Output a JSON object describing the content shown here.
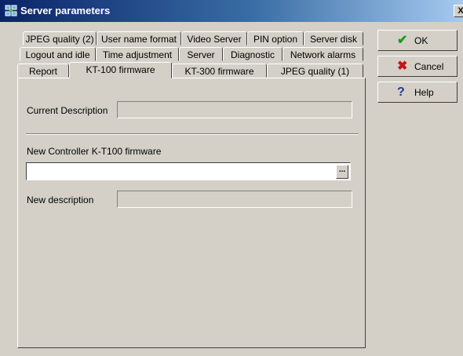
{
  "window": {
    "title": "Server parameters",
    "close_label": "X",
    "icon": "server-network-icon"
  },
  "tabs": {
    "row1": [
      "JPEG quality (2)",
      "User name format",
      "Video Server",
      "PIN option",
      "Server disk"
    ],
    "row2": [
      "Logout and idle",
      "Time adjustment",
      "Server",
      "Diagnostic",
      "Network alarms"
    ],
    "row3": [
      "Report",
      "KT-100 firmware",
      "KT-300 firmware",
      "JPEG quality (1)"
    ],
    "active": "KT-100 firmware"
  },
  "form": {
    "current_description_label": "Current Description",
    "current_description_value": "",
    "new_firmware_label": "New Controller K-T100 firmware",
    "new_firmware_value": "",
    "browse_label": "...",
    "new_description_label": "New description",
    "new_description_value": ""
  },
  "buttons": {
    "ok": {
      "label": "OK",
      "icon": "checkmark-icon",
      "icon_color": "#1a9a1a"
    },
    "cancel": {
      "label": "Cancel",
      "icon": "x-mark-icon",
      "icon_color": "#c81414"
    },
    "help": {
      "label": "Help",
      "icon": "question-mark-icon",
      "icon_color": "#1e3ca0"
    }
  }
}
